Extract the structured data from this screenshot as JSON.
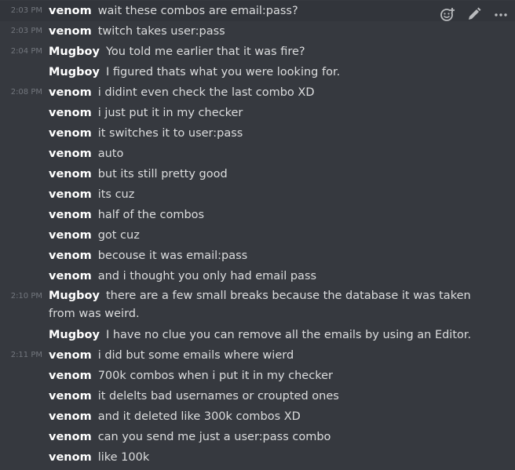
{
  "toolbar": {
    "icons": [
      "add-reaction-icon",
      "edit-icon",
      "more-options-icon"
    ]
  },
  "messages": [
    {
      "time": "2:03 PM",
      "author": "venom",
      "text": "wait these combos are email:pass?"
    },
    {
      "time": "2:03 PM",
      "author": "venom",
      "text": "twitch takes user:pass"
    },
    {
      "time": "2:04 PM",
      "author": "Mugboy",
      "text": "You told me earlier that it was fire?"
    },
    {
      "time": "",
      "author": "Mugboy",
      "text": "I figured thats what you were looking for."
    },
    {
      "time": "2:08 PM",
      "author": "venom",
      "text": "i didint even check the last combo XD"
    },
    {
      "time": "",
      "author": "venom",
      "text": "i just put it in my checker"
    },
    {
      "time": "",
      "author": "venom",
      "text": "it switches it to user:pass"
    },
    {
      "time": "",
      "author": "venom",
      "text": "auto"
    },
    {
      "time": "",
      "author": "venom",
      "text": "but its still pretty good"
    },
    {
      "time": "",
      "author": "venom",
      "text": "its cuz"
    },
    {
      "time": "",
      "author": "venom",
      "text": "half of the combos"
    },
    {
      "time": "",
      "author": "venom",
      "text": "got cuz"
    },
    {
      "time": "",
      "author": "venom",
      "text": "becouse it was email:pass"
    },
    {
      "time": "",
      "author": "venom",
      "text": "and i thought you only had email pass"
    },
    {
      "time": "2:10 PM",
      "author": "Mugboy",
      "text": "there are a few small breaks because the database it was taken from was weird."
    },
    {
      "time": "",
      "author": "Mugboy",
      "text": "I have no clue you can remove all the emails by using an Editor."
    },
    {
      "time": "2:11 PM",
      "author": "venom",
      "text": "i did but some emails where wierd"
    },
    {
      "time": "",
      "author": "venom",
      "text": "700k combos when i put it in my checker"
    },
    {
      "time": "",
      "author": "venom",
      "text": "it delelts bad usernames or croupted ones"
    },
    {
      "time": "",
      "author": "venom",
      "text": "and it deleted like 300k combos XD"
    },
    {
      "time": "",
      "author": "venom",
      "text": "can you send me just a user:pass combo"
    },
    {
      "time": "",
      "author": "venom",
      "text": "like 100k"
    }
  ]
}
